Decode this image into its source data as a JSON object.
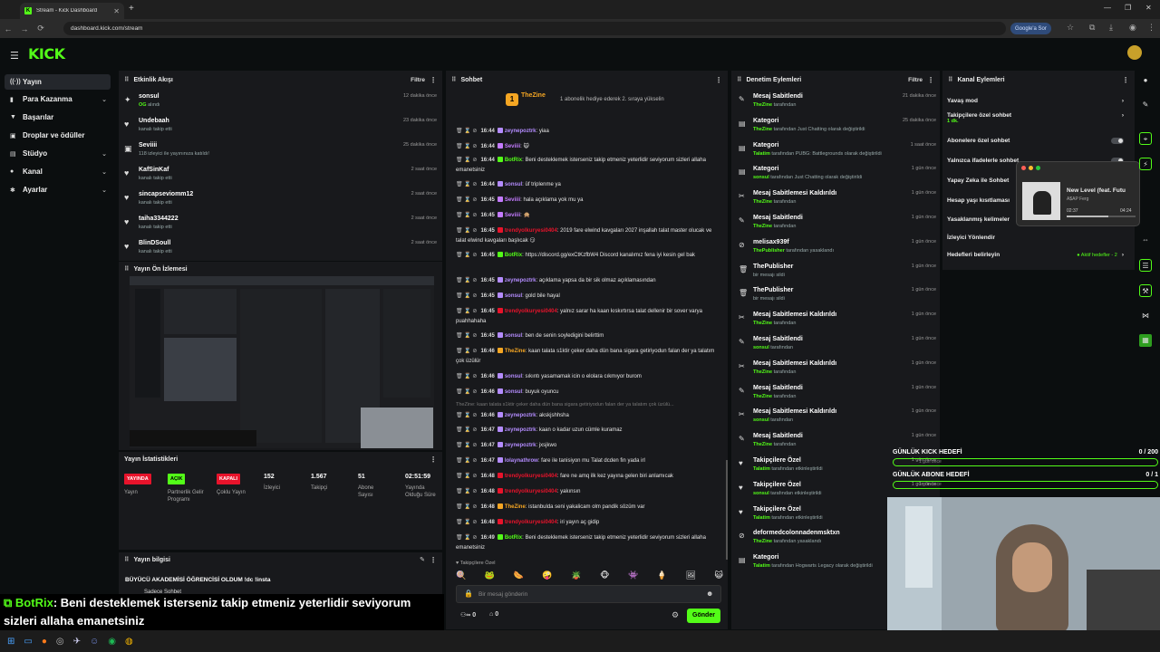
{
  "browser": {
    "tab_title": "Stream - Kick Dashboard",
    "url": "dashboard.kick.com/stream",
    "google_label": "Google'a Sor"
  },
  "brand": {
    "logo": "KICK",
    "accent": "#53fc18"
  },
  "sidebar": {
    "items": [
      {
        "label": "Yayın",
        "icon": "broadcast-icon"
      },
      {
        "label": "Para Kazanma",
        "icon": "money-icon"
      },
      {
        "label": "Başarılar",
        "icon": "trophy-icon"
      },
      {
        "label": "Droplar ve ödüller",
        "icon": "gift-icon"
      },
      {
        "label": "Stüdyo",
        "icon": "studio-icon"
      },
      {
        "label": "Kanal",
        "icon": "user-icon"
      },
      {
        "label": "Ayarlar",
        "icon": "gear-icon"
      }
    ]
  },
  "activity": {
    "title": "Etkinlik Akışı",
    "filter": "Filtre",
    "events": [
      {
        "name": "sonsul",
        "sub": "OG",
        "sub2": "alındı",
        "time": "12 dakika önce"
      },
      {
        "name": "Undebaah",
        "sub": "kanalı takip etti",
        "time": "23 dakika önce"
      },
      {
        "name": "Seviiii",
        "sub": "118 izleyici ile yayınınıza katıldı!",
        "time": "25 dakika önce"
      },
      {
        "name": "KafSinKaf",
        "sub": "kanalı takip etti",
        "time": "2 saat önce"
      },
      {
        "name": "sincapseviomm12",
        "sub": "kanalı takip etti",
        "time": "2 saat önce"
      },
      {
        "name": "taiha3344222",
        "sub": "kanalı takip etti",
        "time": "2 saat önce"
      },
      {
        "name": "BlinDSoull",
        "sub": "kanalı takip etti",
        "time": "2 saat önce"
      }
    ]
  },
  "preview": {
    "title": "Yayın Ön İzlemesi"
  },
  "stats": {
    "title": "Yayın İstatistikleri",
    "items": [
      {
        "badge": "YAYINDA",
        "label": "Yayın",
        "color": "#e8132b"
      },
      {
        "badge": "AÇIK",
        "label": "Partnerlik Gelir Programı",
        "color": "#53fc18"
      },
      {
        "badge": "KAPALI",
        "label": "Çoklu Yayın",
        "color": "#e8132b"
      },
      {
        "value": "152",
        "label": "İzleyici"
      },
      {
        "value": "1.567",
        "label": "Takipçi"
      },
      {
        "value": "51",
        "label": "Abone Sayısı"
      },
      {
        "value": "02:51:59",
        "label": "Yayında Olduğu Süre"
      }
    ]
  },
  "info": {
    "title": "Yayın bilgisi",
    "stream_title": "BÜYÜCÜ AKADEMİSİ ÖĞRENCİSİ OLDUM !dc !insta",
    "category": "Sadece Sohbet"
  },
  "overlay": {
    "user": "BotRix",
    "line1": ": Beni desteklemek isterseniz takip etmeniz yeterlidir seviyorum",
    "line2": "sizleri allaha emanetsiniz"
  },
  "chat": {
    "title": "Sohbet",
    "pinned_user": "TheZine",
    "pinned_text": "1 abonelik hediye ederek 2. sıraya yükselin",
    "messages": [
      {
        "t": "16:44",
        "u": "zeynepoztrk",
        "c": "#b48cff",
        "m": ": yiaa"
      },
      {
        "t": "16:44",
        "u": "Seviiii",
        "c": "#c47bff",
        "m": ": 🙀"
      },
      {
        "t": "16:44",
        "u": "BotRix",
        "c": "#53fc18",
        "m": ": Beni desteklemek isterseniz takip etmeniz yeterlidir seviyorum sizleri allaha emanetsiniz"
      },
      {
        "t": "16:44",
        "u": "sonsul",
        "c": "#b48cff",
        "m": ": üf triplenme ya"
      },
      {
        "t": "16:45",
        "u": "Seviiii",
        "c": "#c47bff",
        "m": ": hala açıklama yok mu ya"
      },
      {
        "t": "16:45",
        "u": "Seviiii",
        "c": "#c47bff",
        "m": ": 🙊"
      },
      {
        "t": "16:45",
        "u": "trendyolkuryesi0404",
        "c": "#e8132b",
        "m": ": 2019 fare elwind kavgaları 2027 inşallah talat master olucak ve talat elwind kavgaları başlıcak 😏"
      },
      {
        "t": "16:45",
        "u": "BotRix",
        "c": "#53fc18",
        "m": ": https://discord.gg/exCtKzfbW4 Discord kanalımız fena iyi kesin gel bak"
      },
      {
        "t": "16:45",
        "u": "zeynepoztrk",
        "c": "#b48cff",
        "m": ": açıklama yapsa da bir sik olmaz açıklamasından"
      },
      {
        "t": "16:45",
        "u": "sonsul",
        "c": "#b48cff",
        "m": ": gold bile hayal"
      },
      {
        "t": "16:45",
        "u": "trendyolkuryesi0404",
        "c": "#e8132b",
        "m": ": yalnız sarar ha kaan kıskırtırsa talat dellenir bir sover varya puahhahaha"
      },
      {
        "t": "16:45",
        "u": "sonsul",
        "c": "#b48cff",
        "m": ": ben de senin soyledigini belirttim"
      },
      {
        "t": "16:46",
        "u": "TheZine",
        "c": "#f5a623",
        "m": ": kaan talata s1ktir çeker daha dün bana sigara getiriyodun falan der ya talatım çok üzülür"
      },
      {
        "t": "16:46",
        "u": "sonsul",
        "c": "#b48cff",
        "m": ": sıkıntı yasamamak icin o elolara cıkmıyor burom"
      },
      {
        "t": "16:46",
        "u": "sonsul",
        "c": "#b48cff",
        "m": ": buyuk oyuncu"
      },
      {
        "t": "16:46",
        "u": "zeynepoztrk",
        "c": "#b48cff",
        "m": ": akskjshhsha"
      },
      {
        "t": "16:47",
        "u": "zeynepoztrk",
        "c": "#b48cff",
        "m": ": kaan o kadar uzun cümle kuramaz"
      },
      {
        "t": "16:47",
        "u": "zeynepoztrk",
        "c": "#b48cff",
        "m": ": jxsjkwo"
      },
      {
        "t": "16:47",
        "u": "lolaynathrow",
        "c": "#b48cff",
        "m": ": fare ile tanisiyon mu Talat dcden fin yada irl"
      },
      {
        "t": "16:48",
        "u": "trendyolkuryesi0404",
        "c": "#e8132b",
        "m": ": fare ne amq ilk kez yayına gelen biri anlamıcak"
      },
      {
        "t": "16:48",
        "u": "trendyolkuryesi0404",
        "c": "#e8132b",
        "m": ": yakınsın"
      },
      {
        "t": "16:48",
        "u": "TheZine",
        "c": "#f5a623",
        "m": ": istanbulda seni yakalicam olm pandik sözüm var"
      },
      {
        "t": "16:48",
        "u": "trendyolkuryesi0404",
        "c": "#e8132b",
        "m": ": iri yayın aç gidip"
      },
      {
        "t": "16:49",
        "u": "BotRix",
        "c": "#53fc18",
        "m": ": Beni desteklemek isterseniz takip etmeniz yeterlidir seviyorum sizleri allaha emanetsiniz"
      }
    ],
    "reply_context": "TheZine: kaan talata s1ktir çeker daha dün bana sigara getiriyodun falan der ya talatım çok üzülü...",
    "followers_only": "Takipçilere Özel",
    "input_placeholder": "Bir mesaj gönderin",
    "send_label": "Gönder",
    "count_left": "0",
    "count_right": "0"
  },
  "moderation": {
    "title": "Denetim Eylemleri",
    "filter": "Filtre",
    "actions": [
      {
        "n": "Mesaj Sabitlendi",
        "by": "TheZine",
        "s": "tarafından",
        "tm": "21 dakika önce",
        "icon": "pin-icon"
      },
      {
        "n": "Kategori",
        "by": "TheZine",
        "s": "tarafından Just Chatting olarak değiştirildi",
        "tm": "25 dakika önce",
        "icon": "category-icon"
      },
      {
        "n": "Kategori",
        "by": "Talatim",
        "s": "tarafından PUBG: Battlegrounds olarak değiştirildi",
        "tm": "1 saat önce",
        "icon": "category-icon"
      },
      {
        "n": "Kategori",
        "by": "sonsul",
        "s": "tarafından Just Chatting olarak değiştirildi",
        "tm": "1 gün önce",
        "icon": "category-icon"
      },
      {
        "n": "Mesaj Sabitlemesi Kaldırıldı",
        "by": "TheZine",
        "s": "tarafından",
        "tm": "1 gün önce",
        "icon": "unpin-icon"
      },
      {
        "n": "Mesaj Sabitlendi",
        "by": "TheZine",
        "s": "tarafından",
        "tm": "1 gün önce",
        "icon": "pin-icon"
      },
      {
        "n": "melisax939f",
        "by": "ThePublisher",
        "s": "tarafından yasaklandı",
        "tm": "1 gün önce",
        "icon": "ban-icon"
      },
      {
        "n": "ThePublisher",
        "by": "",
        "s": "bir mesajı sildi",
        "tm": "1 gün önce",
        "icon": "trash-icon"
      },
      {
        "n": "ThePublisher",
        "by": "",
        "s": "bir mesajı sildi",
        "tm": "1 gün önce",
        "icon": "trash-icon"
      },
      {
        "n": "Mesaj Sabitlemesi Kaldırıldı",
        "by": "TheZine",
        "s": "tarafından",
        "tm": "1 gün önce",
        "icon": "unpin-icon"
      },
      {
        "n": "Mesaj Sabitlendi",
        "by": "sonsul",
        "s": "tarafından",
        "tm": "1 gün önce",
        "icon": "pin-icon"
      },
      {
        "n": "Mesaj Sabitlemesi Kaldırıldı",
        "by": "TheZine",
        "s": "tarafından",
        "tm": "1 gün önce",
        "icon": "unpin-icon"
      },
      {
        "n": "Mesaj Sabitlendi",
        "by": "TheZine",
        "s": "tarafından",
        "tm": "1 gün önce",
        "icon": "pin-icon"
      },
      {
        "n": "Mesaj Sabitlemesi Kaldırıldı",
        "by": "sonsul",
        "s": "tarafından",
        "tm": "1 gün önce",
        "icon": "unpin-icon"
      },
      {
        "n": "Mesaj Sabitlendi",
        "by": "TheZine",
        "s": "tarafından",
        "tm": "1 gün önce",
        "icon": "pin-icon"
      },
      {
        "n": "Takipçilere Özel",
        "by": "Talatim",
        "s": "tarafından etkinleştirildi",
        "tm": "1 gün önce",
        "icon": "heart-icon"
      },
      {
        "n": "Takipçilere Özel",
        "by": "sonsul",
        "s": "tarafından etkinleştirildi",
        "tm": "1 gün önce",
        "icon": "heart-icon"
      },
      {
        "n": "Takipçilere Özel",
        "by": "Talatim",
        "s": "tarafından etkinleştirildi",
        "tm": "1 gün önce",
        "icon": "heart-icon"
      },
      {
        "n": "deformedcolonnadenmsktxn",
        "by": "TheZine",
        "s": "tarafından yasaklandı",
        "tm": "1 gün önce",
        "icon": "ban-icon"
      },
      {
        "n": "Kategori",
        "by": "Talatim",
        "s": "tarafından Hogwarts Legacy olarak değiştirildi",
        "tm": "1 gün önce",
        "icon": "category-icon"
      }
    ]
  },
  "channel_actions": {
    "title": "Kanal Eylemleri",
    "items": [
      {
        "label": "Yavaş mod"
      },
      {
        "label": "Takipçilere özel sohbet",
        "sub": "1 dk."
      },
      {
        "label": "Abonelere özel sohbet"
      },
      {
        "label": "Yalnızca ifadelerle sohbet"
      },
      {
        "label": "Yapay Zeka ile Sohbet"
      },
      {
        "label": "Hesap yaşı kısıtlaması"
      },
      {
        "label": "Yasaklanmış kelimeler"
      },
      {
        "label": "İzleyici Yönlendir"
      },
      {
        "label": "Hedefleri belirleyin",
        "extra": "Aktif hedefler - 2"
      }
    ]
  },
  "music": {
    "title": "New Level (feat. Futu",
    "artist": "A$AP Ferg",
    "elapsed": "02:37",
    "total": "04:24",
    "progress": 0.6
  },
  "goals": [
    {
      "title": "GÜNLÜK KICK HEDEFİ",
      "count": "0 / 200",
      "sub": "1 gün önce"
    },
    {
      "title": "GÜNLÜK ABONE HEDEFİ",
      "count": "0 / 1",
      "sub": "1 gün önce"
    }
  ]
}
